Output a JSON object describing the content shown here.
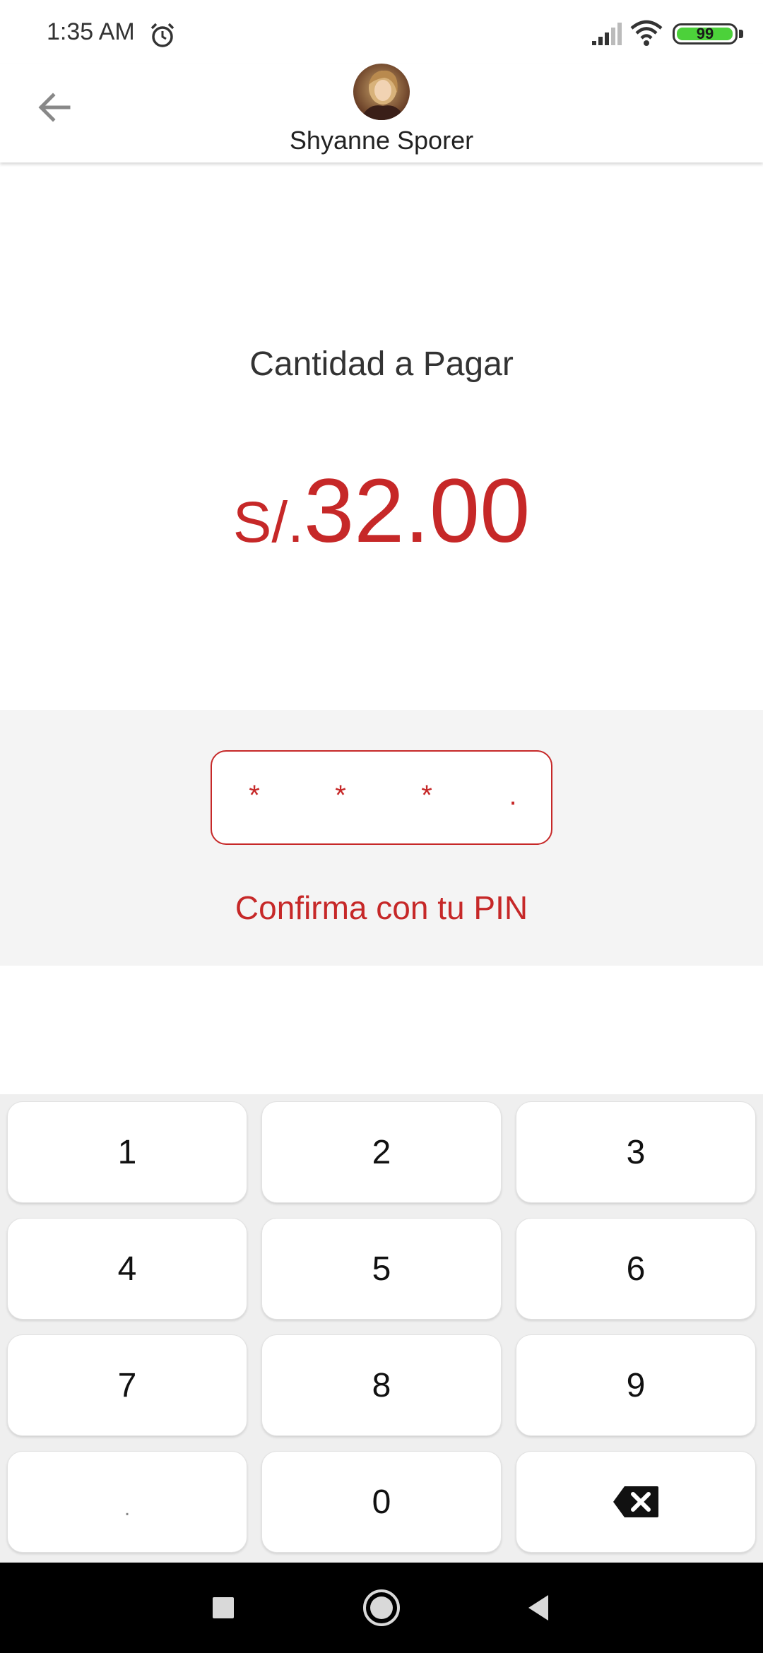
{
  "status_bar": {
    "time": "1:35 AM",
    "battery": "99",
    "battery_level": 0.99
  },
  "header": {
    "contact_name": "Shyanne Sporer",
    "back_icon": "arrow-left-icon"
  },
  "payment": {
    "label": "Cantidad a Pagar",
    "currency": "S/.",
    "amount": "32.00"
  },
  "pin": {
    "masked_digits": [
      "*",
      "*",
      "*",
      "."
    ],
    "hint": "Confirma con tu PIN"
  },
  "keypad": {
    "keys": [
      "1",
      "2",
      "3",
      "4",
      "5",
      "6",
      "7",
      "8",
      "9",
      ".",
      "0",
      "backspace-icon"
    ]
  },
  "colors": {
    "accent": "#c62828",
    "pin_background": "#f4f4f4",
    "keypad_background": "#efefef",
    "battery_fill": "#4cd13a"
  },
  "nav_bar": {
    "icons": [
      "recents-square-icon",
      "home-circle-icon",
      "back-triangle-icon"
    ]
  }
}
